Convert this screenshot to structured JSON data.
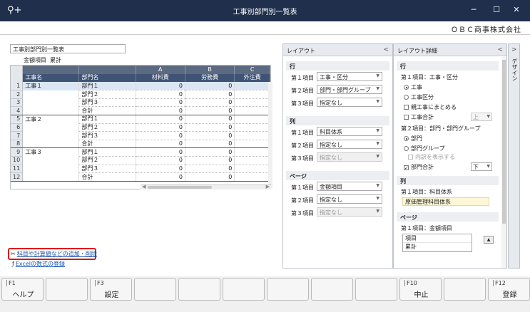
{
  "window": {
    "app_icon": "search-plus-icon",
    "title": "工事別部門別一覧表",
    "company": "ＯＢＣ商事株式会社"
  },
  "report": {
    "name": "工事別部門別一覧表",
    "amount_label": "金額項目",
    "amount_value": "累計",
    "col_letters": [
      "A",
      "B",
      "C"
    ],
    "col_headers": [
      "工事名",
      "部門名",
      "材料費",
      "労務費",
      "外注費"
    ],
    "rows": [
      {
        "n": "1",
        "c1": "工事１",
        "c2": "部門１",
        "a": "0",
        "b": "0"
      },
      {
        "n": "2",
        "c1": "",
        "c2": "部門２",
        "a": "0",
        "b": "0"
      },
      {
        "n": "3",
        "c1": "",
        "c2": "部門３",
        "a": "0",
        "b": "0"
      },
      {
        "n": "4",
        "c1": "",
        "c2": "合計",
        "a": "0",
        "b": "0"
      },
      {
        "n": "5",
        "c1": "工事２",
        "c2": "部門１",
        "a": "0",
        "b": "0"
      },
      {
        "n": "6",
        "c1": "",
        "c2": "部門２",
        "a": "0",
        "b": "0"
      },
      {
        "n": "7",
        "c1": "",
        "c2": "部門３",
        "a": "0",
        "b": "0"
      },
      {
        "n": "8",
        "c1": "",
        "c2": "合計",
        "a": "0",
        "b": "0"
      },
      {
        "n": "9",
        "c1": "工事３",
        "c2": "部門１",
        "a": "0",
        "b": "0"
      },
      {
        "n": "10",
        "c1": "",
        "c2": "部門２",
        "a": "0",
        "b": "0"
      },
      {
        "n": "11",
        "c1": "",
        "c2": "部門３",
        "a": "0",
        "b": "0"
      },
      {
        "n": "12",
        "c1": "",
        "c2": "合計",
        "a": "0",
        "b": "0"
      }
    ]
  },
  "links": {
    "add_items": "科目や計算値などの追加・削除",
    "excel": "Excelの数式の登録"
  },
  "layout": {
    "title": "レイアウト",
    "row_section": "行",
    "col_section": "列",
    "page_section": "ページ",
    "item1": "第１項目",
    "item2": "第２項目",
    "item3": "第３項目",
    "row_values": [
      "工事・区分",
      "部門・部門グループ",
      "指定なし"
    ],
    "col_values": [
      "科目体系",
      "指定なし",
      "指定なし"
    ],
    "page_values": [
      "金額項目",
      "指定なし",
      "指定なし"
    ]
  },
  "detail": {
    "title": "レイアウト詳細",
    "row_section": "行",
    "item1_label": "第１項目：工事・区分",
    "opt_kouji": "工事",
    "opt_kubun": "工事区分",
    "chk_oya": "親工事にまとめる",
    "chk_kouji_total": "工事合計",
    "pos_up": "上",
    "item2_label": "第２項目：部門・部門グループ",
    "opt_bumon": "部門",
    "opt_bumon_group": "部門グループ",
    "chk_breakdown": "内訳を表示する",
    "chk_bumon_total": "部門合計",
    "pos_down": "下",
    "col_section": "列",
    "col_item1_label": "第１項目：科目体系",
    "col_item1_value": "原価管理科目体系",
    "page_section": "ページ",
    "page_item1_label": "第１項目：金額項目",
    "page_list": [
      "項目",
      "累計"
    ]
  },
  "design_tab": {
    "label": "デザイン"
  },
  "fkeys": [
    {
      "key": "F1",
      "label": "ヘルプ"
    },
    {
      "key": "",
      "label": ""
    },
    {
      "key": "F3",
      "label": "設定"
    },
    {
      "key": "",
      "label": ""
    },
    {
      "key": "",
      "label": ""
    },
    {
      "key": "",
      "label": ""
    },
    {
      "key": "",
      "label": ""
    },
    {
      "key": "",
      "label": ""
    },
    {
      "key": "",
      "label": ""
    },
    {
      "key": "F10",
      "label": "中止"
    },
    {
      "key": "",
      "label": ""
    },
    {
      "key": "F12",
      "label": "登録"
    }
  ]
}
